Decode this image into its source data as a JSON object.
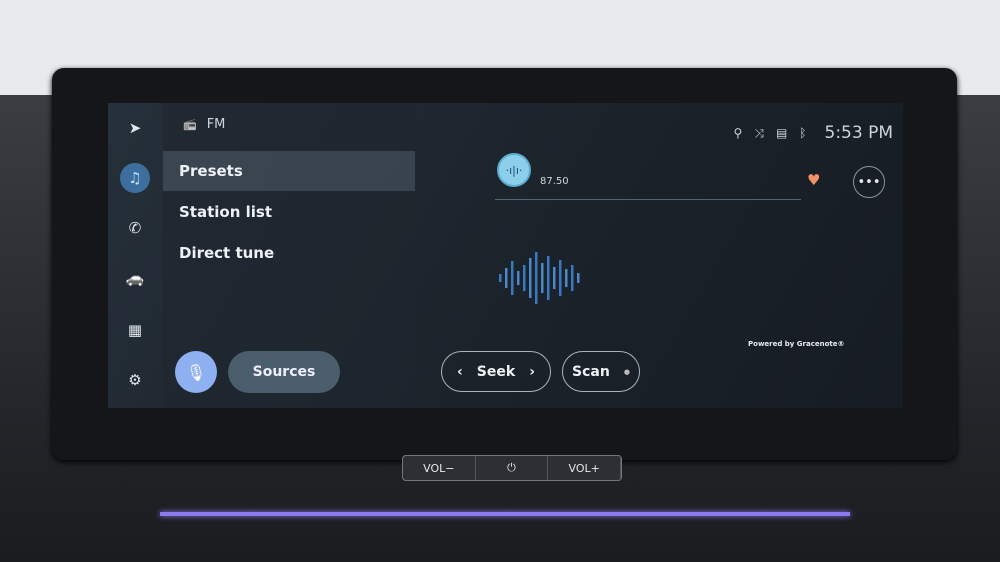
{
  "rail": {
    "items": [
      {
        "icon": "navigation-icon",
        "glyph": "➤"
      },
      {
        "icon": "music-note-icon",
        "glyph": "♫",
        "active": true
      },
      {
        "icon": "phone-icon",
        "glyph": "✆"
      },
      {
        "icon": "car-icon",
        "glyph": "🚗"
      },
      {
        "icon": "apps-grid-icon",
        "glyph": "▦"
      },
      {
        "icon": "settings-gear-icon",
        "glyph": "⚙"
      }
    ]
  },
  "source": {
    "icon": "radio-icon",
    "glyph": "📻",
    "label": "FM"
  },
  "menu": {
    "items": [
      {
        "label": "Presets",
        "selected": true
      },
      {
        "label": "Station list"
      },
      {
        "label": "Direct tune"
      }
    ]
  },
  "mic": {
    "icon": "microphone-icon",
    "glyph": "🎙"
  },
  "sources_label": "Sources",
  "status": {
    "icons": [
      "location-icon",
      "shuffle-icon",
      "display-icon",
      "bluetooth-icon"
    ],
    "glyphs": [
      "⚲",
      "⤨",
      "▤",
      "ᛒ"
    ],
    "time": "5:53 PM"
  },
  "station": {
    "frequency": "87.50",
    "logo_glyph": "·ı|ı·"
  },
  "favorite": {
    "icon": "heart-icon",
    "glyph": "♥",
    "color": "#f4936a"
  },
  "more": {
    "glyph": "•••"
  },
  "attribution": "Powered by Gracenote®",
  "controls": {
    "seek": "Seek",
    "seek_prev": "‹",
    "seek_next": "›",
    "scan": "Scan",
    "scan_dot": "●"
  },
  "hardware": {
    "vol_down": "VOL−",
    "power": "⏻",
    "vol_up": "VOL+"
  },
  "accent": "#3c6f9e"
}
